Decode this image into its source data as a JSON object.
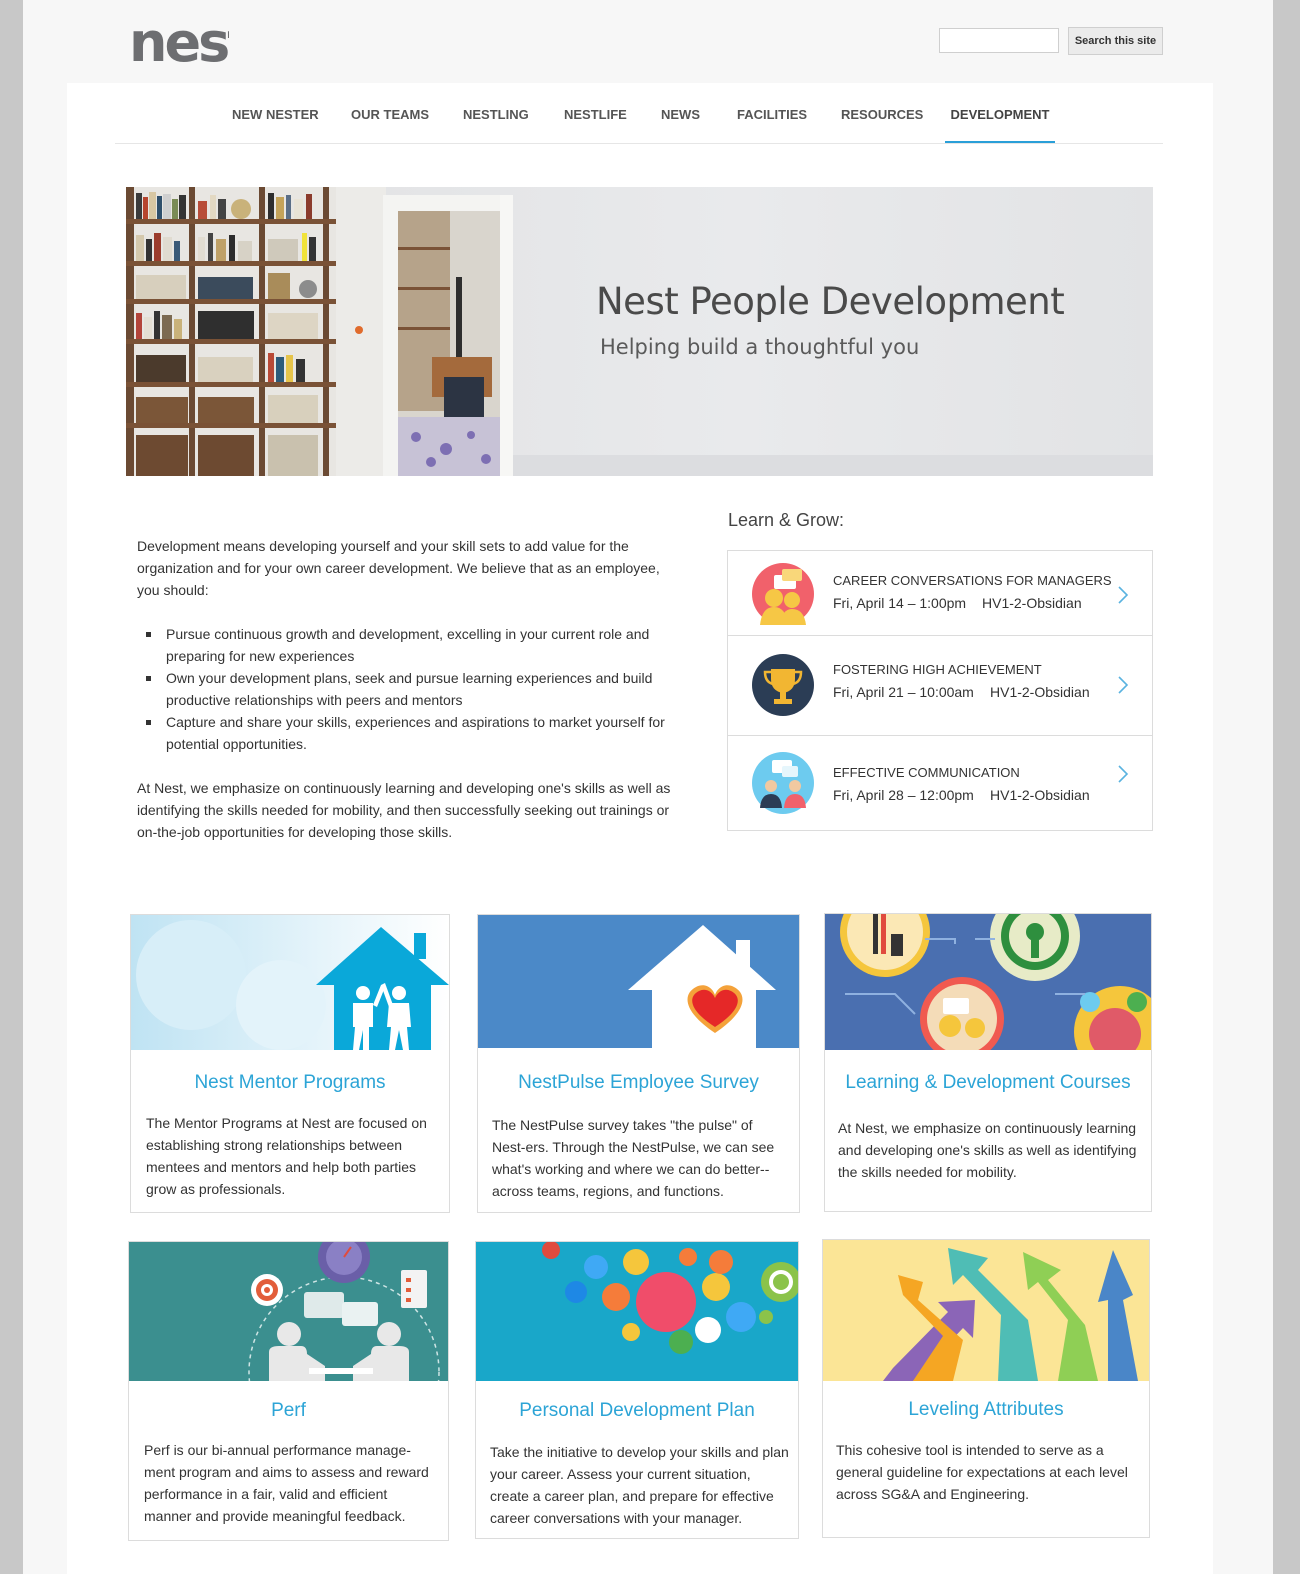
{
  "site": {
    "logo_text": "nest",
    "search_placeholder": "",
    "search_button": "Search this site"
  },
  "nav": [
    {
      "label": "NEW NESTER"
    },
    {
      "label": "OUR TEAMS"
    },
    {
      "label": "NESTLING"
    },
    {
      "label": "NESTLIFE"
    },
    {
      "label": "NEWS"
    },
    {
      "label": "FACILITIES"
    },
    {
      "label": "RESOURCES"
    },
    {
      "label": "DEVELOPMENT",
      "active": true
    }
  ],
  "hero": {
    "title": "Nest People Development",
    "subtitle": "Helping build a thoughtful you"
  },
  "intro": {
    "p1": "Development means developing yourself and your skill sets to add value for the organization and for your own career development. We believe that as an employee, you should:",
    "bullets": [
      "Pursue continuous growth and development, excelling in your current role and preparing for new experiences",
      "Own your development plans, seek and pursue learning experiences and build productive relationships with peers and mentors",
      "Capture and share your skills, experiences and aspirations to market yourself for potential opportunities."
    ],
    "p2": "At Nest, we emphasize on continuously learning and developing one's skills as well as identifying the skills needed for mobility, and then successfully seeking out trainings or on-the-job opportunities for developing those skills."
  },
  "learn_grow": {
    "heading": "Learn & Grow:",
    "events": [
      {
        "title": "CAREER CONVERSATIONS FOR MANAGERS",
        "date": "Fri, April 14 – 1:00pm",
        "location": "HV1-2-Obsidian",
        "icon": "conversation-icon"
      },
      {
        "title": "FOSTERING HIGH ACHIEVEMENT",
        "date": "Fri, April 21 – 10:00am",
        "location": "HV1-2-Obsidian",
        "icon": "trophy-icon"
      },
      {
        "title": "EFFECTIVE COMMUNICATION",
        "date": "Fri, April 28 – 12:00pm",
        "location": "HV1-2-Obsidian",
        "icon": "communication-icon"
      }
    ]
  },
  "cards": [
    {
      "title": "Nest Mentor Programs",
      "desc": "The Mentor Programs at Nest are focused on establishing strong relationships between mentees and mentors and help both parties grow as professionals."
    },
    {
      "title": "NestPulse Employee Survey",
      "desc": "The NestPulse survey takes \"the pulse\" of Nest-ers. Through the NestPulse, we can see what's working and where we can do better--across teams, regions, and functions."
    },
    {
      "title": "Learning & Development Courses",
      "desc": "At Nest, we emphasize on continuously learning and developing one's skills as well as identifying the skills needed for mobility."
    },
    {
      "title": "Perf",
      "desc": "Perf is our bi-annual performance manage-ment program and aims to assess and reward performance in a fair, valid and efficient manner and provide meaningful feedback."
    },
    {
      "title": "Personal Development Plan",
      "desc": "Take the initiative to develop your skills and plan your career. Assess your current situation, create a career plan, and prepare for effective career conversations with your manager."
    },
    {
      "title": "Leveling Attributes",
      "desc": "This cohesive tool is intended to serve as a general guideline for expectations at each level across SG&A and Engineering."
    }
  ],
  "colors": {
    "accent": "#2ca4d6",
    "nav_active_underline": "#2a9fd8",
    "logo": "#6d6e71"
  }
}
